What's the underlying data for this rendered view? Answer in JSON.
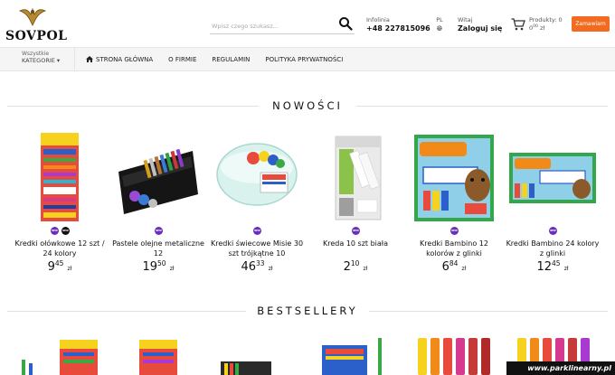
{
  "brand": {
    "logo_text": "SOVPOL"
  },
  "search": {
    "placeholder": "Wpisz czego szukasz..."
  },
  "info": {
    "label": "Infolinia",
    "phone": "+48 227815096"
  },
  "lang": {
    "code": "PL"
  },
  "account": {
    "greeting": "Witaj",
    "login_label": "Zaloguj się"
  },
  "cart": {
    "products_label": "Produkty: 0",
    "total_main": "0",
    "total_fraction": "00",
    "currency": "zł"
  },
  "order_button": "Zamawiam",
  "nav": {
    "categories_small": "Wszystkie",
    "categories_big": "KATEGORIE ▾",
    "items": [
      {
        "label": "STRONA GŁÓWNA"
      },
      {
        "label": "O FIRMIE"
      },
      {
        "label": "REGULAMIN"
      },
      {
        "label": "POLITYKA PRYWATNOŚCI"
      }
    ]
  },
  "sections": {
    "new": "NOWOŚCI",
    "best": "BESTSELLERY"
  },
  "badge_text": "NEW",
  "currency": "zł",
  "products": [
    {
      "name": "Kredki ołówkowe 12 szt / 24 kolory",
      "price_main": "9",
      "price_fraction": "45"
    },
    {
      "name": "Pastele olejne metaliczne 12",
      "price_main": "19",
      "price_fraction": "50"
    },
    {
      "name": "Kredki świecowe Misie 30 szt trójkątne 10",
      "price_main": "46",
      "price_fraction": "33"
    },
    {
      "name": "Kreda 10 szt biała",
      "price_main": "2",
      "price_fraction": "10"
    },
    {
      "name": "Kredki Bambino 12 kolorów z glinki",
      "price_main": "6",
      "price_fraction": "84"
    },
    {
      "name": "Kredki Bambino 24 kolory z glinki",
      "price_main": "12",
      "price_fraction": "45"
    }
  ],
  "watermark": "www.parklinearny.pl",
  "colors": {
    "accent": "#f26b21",
    "badge": "#6a2fb8"
  }
}
